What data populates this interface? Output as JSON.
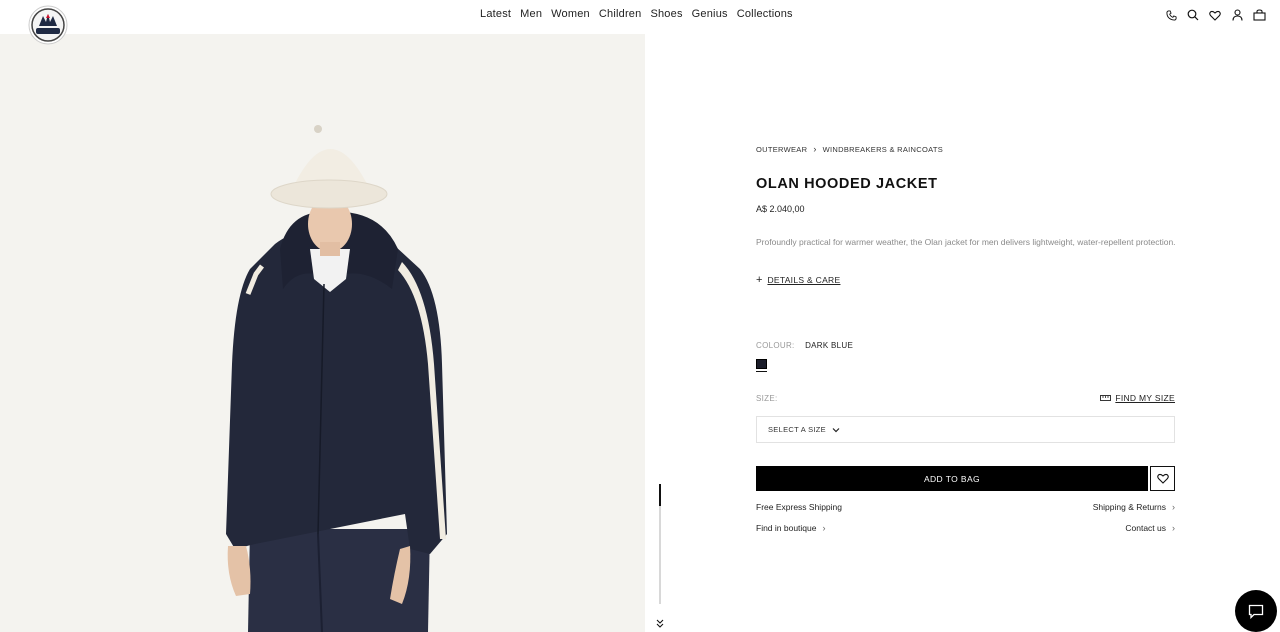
{
  "header": {
    "logo_text": "MONCLER",
    "nav": [
      "Latest",
      "Men",
      "Women",
      "Children",
      "Shoes",
      "Genius",
      "Collections"
    ],
    "icons": [
      "phone-icon",
      "search-icon",
      "heart-icon",
      "account-icon",
      "bag-icon"
    ]
  },
  "breadcrumb": {
    "level1": "OUTERWEAR",
    "level2": "WINDBREAKERS & RAINCOATS"
  },
  "product": {
    "title": "OLAN HOODED JACKET",
    "price": "A$ 2.040,00",
    "description": "Profoundly practical for warmer weather, the Olan jacket for men delivers lightweight, water-repellent protection.",
    "details_label": "DETAILS & CARE",
    "colour_label": "COLOUR:",
    "colour_value": "DARK BLUE",
    "swatch_color": "#1b1d2a",
    "size_label": "SIZE:",
    "find_size_label": "FIND MY SIZE",
    "size_placeholder": "SELECT A SIZE",
    "add_to_bag": "ADD TO BAG"
  },
  "info": {
    "shipping": "Free Express Shipping",
    "returns": "Shipping & Returns",
    "boutique": "Find in boutique",
    "contact": "Contact us"
  },
  "colors": {
    "image_bg": "#f4f3ef",
    "jacket": "#23283a",
    "accent_black": "#000000"
  }
}
